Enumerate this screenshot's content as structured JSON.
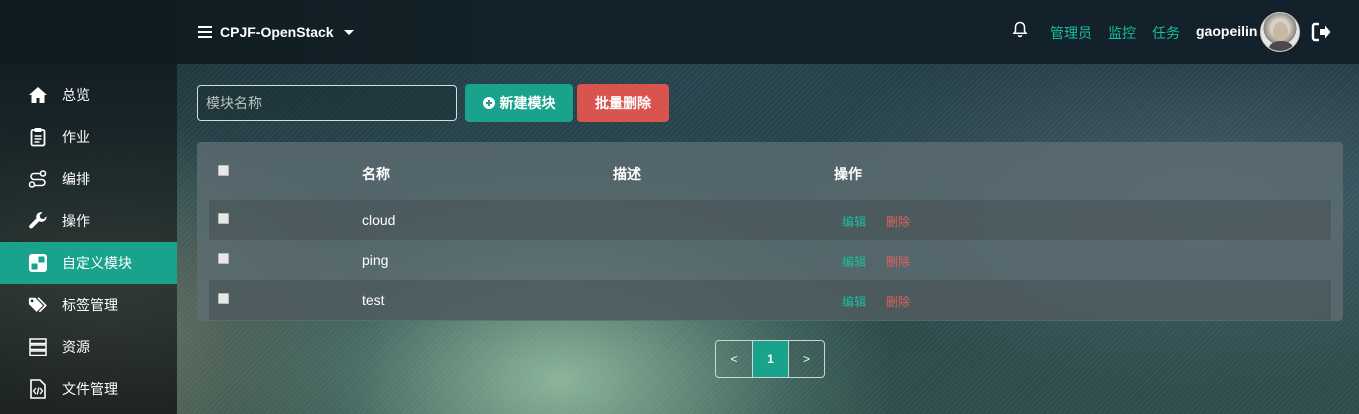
{
  "header": {
    "project": "CPJF-OpenStack",
    "nav": [
      "管理员",
      "监控",
      "任务"
    ],
    "username": "gaopeilin"
  },
  "sidebar": {
    "items": [
      {
        "label": "总览",
        "icon": "home-icon"
      },
      {
        "label": "作业",
        "icon": "clipboard-icon"
      },
      {
        "label": "编排",
        "icon": "route-icon"
      },
      {
        "label": "操作",
        "icon": "wrench-icon"
      },
      {
        "label": "自定义模块",
        "icon": "module-icon",
        "active": true
      },
      {
        "label": "标签管理",
        "icon": "tags-icon"
      },
      {
        "label": "资源",
        "icon": "server-icon"
      },
      {
        "label": "文件管理",
        "icon": "code-file-icon"
      }
    ]
  },
  "toolbar": {
    "search_placeholder": "模块名称",
    "new_label": "新建模块",
    "batch_delete_label": "批量删除"
  },
  "table": {
    "columns": [
      "名称",
      "描述",
      "操作"
    ],
    "rows": [
      {
        "name": "cloud",
        "description": "",
        "edit": "编辑",
        "delete": "删除"
      },
      {
        "name": "ping",
        "description": "",
        "edit": "编辑",
        "delete": "删除"
      },
      {
        "name": "test",
        "description": "",
        "edit": "编辑",
        "delete": "删除"
      }
    ]
  },
  "pagination": {
    "prev": "<",
    "current": "1",
    "next": ">"
  },
  "colors": {
    "accent": "#1aa38c",
    "danger": "#d9534f",
    "topbar": "#13212a"
  }
}
